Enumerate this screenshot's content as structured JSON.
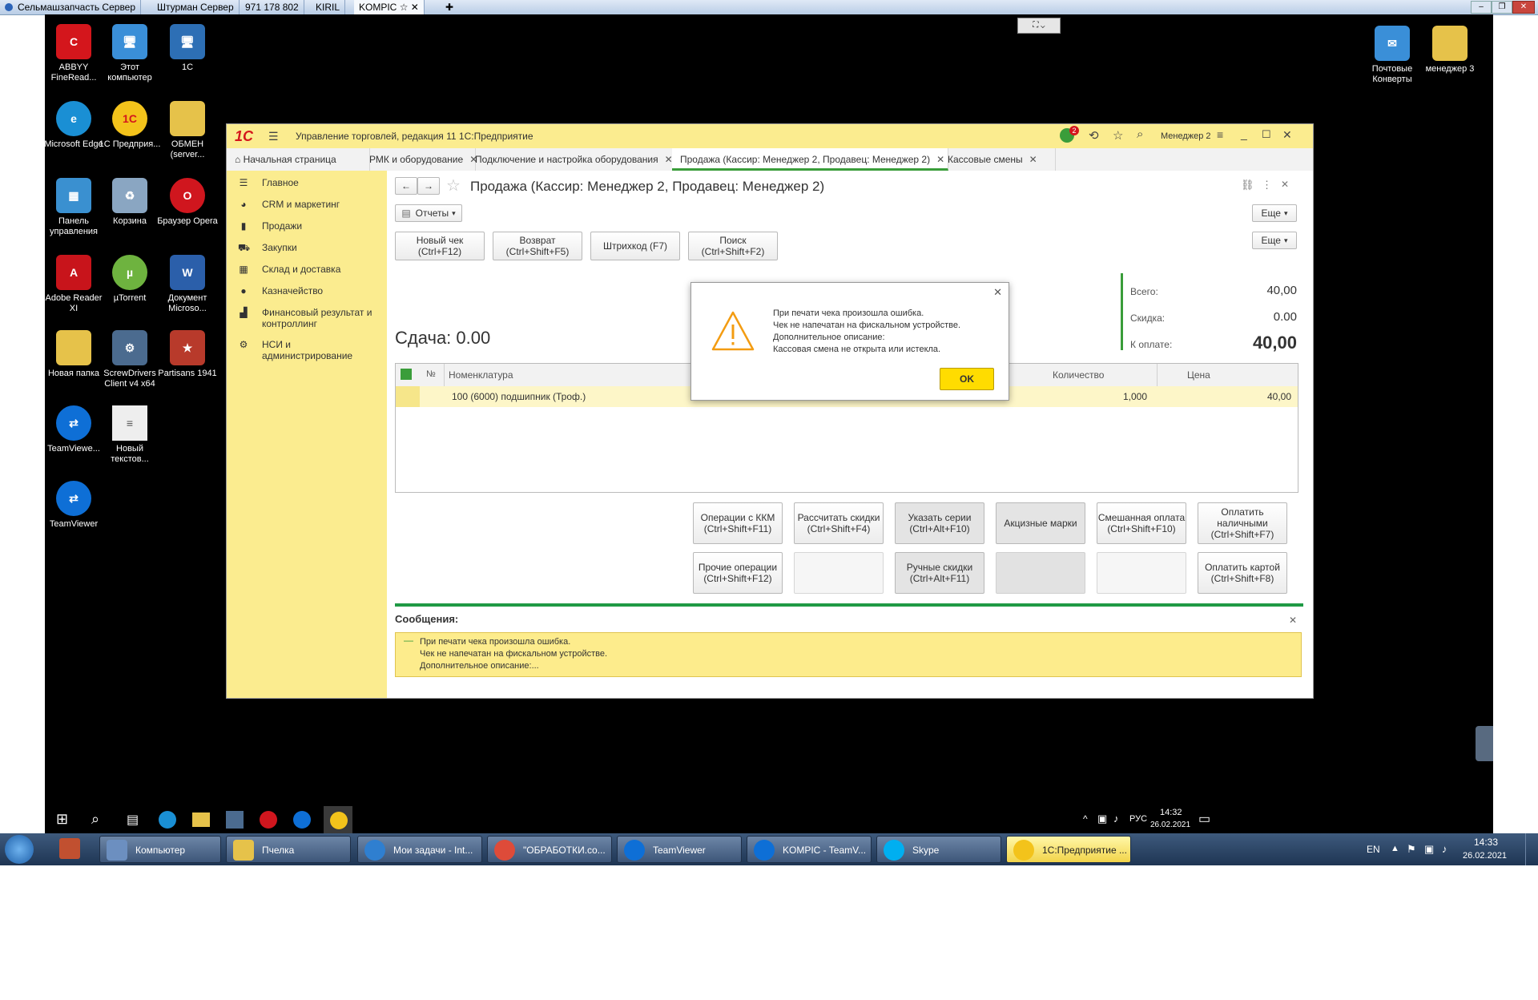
{
  "outer_tabs": [
    "Сельмашзапчасть Сервер",
    "Штурман Сервер",
    "971 178 802",
    "KIRIL",
    "KOMPIC"
  ],
  "desktop_icons": [
    {
      "label": "ABBYY FineRead...",
      "icon": "abbyy-icon",
      "color": "#d4161c"
    },
    {
      "label": "Этот компьютер",
      "icon": "computer-icon",
      "color": "#3a8fd8"
    },
    {
      "label": "1С",
      "icon": "1c-shortcut-icon",
      "color": "#2d6fb5"
    },
    {
      "label": "Microsoft Edge",
      "icon": "edge-icon",
      "color": "#1a8fd4"
    },
    {
      "label": "1С Предприя...",
      "icon": "1c-icon",
      "color": "#f3c31b"
    },
    {
      "label": "ОБМЕН (server...",
      "icon": "folder-icon",
      "color": "#e6c24a"
    },
    {
      "label": "Панель управления",
      "icon": "control-panel-icon",
      "color": "#3a90d0"
    },
    {
      "label": "Корзина",
      "icon": "recycle-bin-icon",
      "color": "#8aa6c2"
    },
    {
      "label": "Браузер Opera",
      "icon": "opera-icon",
      "color": "#d0161e"
    },
    {
      "label": "Adobe Reader XI",
      "icon": "adobe-icon",
      "color": "#c8141b"
    },
    {
      "label": "µTorrent",
      "icon": "utorrent-icon",
      "color": "#6eb33f"
    },
    {
      "label": "Документ Microso...",
      "icon": "word-icon",
      "color": "#2b5faa"
    },
    {
      "label": "Новая папка",
      "icon": "folder-icon",
      "color": "#e6c24a"
    },
    {
      "label": "ScrewDrivers Client v4 x64",
      "icon": "screwdrivers-icon",
      "color": "#4b6b8f"
    },
    {
      "label": "Partisans 1941",
      "icon": "partisans-icon",
      "color": "#b83a2b"
    },
    {
      "label": "TeamViewe...",
      "icon": "teamviewer-icon",
      "color": "#0e6fd6"
    },
    {
      "label": "Новый текстов...",
      "icon": "text-file-icon",
      "color": "#eeeeee"
    },
    {
      "label": "TeamViewer",
      "icon": "teamviewer-icon",
      "color": "#0e6fd6"
    },
    {
      "label": "Почтовые Конверты",
      "icon": "mail-icon",
      "color": "#3a8fd8"
    },
    {
      "label": "менеджер 3",
      "icon": "document-icon",
      "color": "#e6c24a"
    }
  ],
  "app": {
    "logo": "1С",
    "title": "Управление торговлей, редакция 11 1С:Предприятие",
    "user": "Менеджер 2",
    "notif_count": "2"
  },
  "tabs": [
    {
      "label": "Начальная страница"
    },
    {
      "label": "РМК и оборудование"
    },
    {
      "label": "Подключение и настройка оборудования"
    },
    {
      "label": "Продажа (Кассир: Менеджер 2, Продавец: Менеджер 2)"
    },
    {
      "label": "Кассовые смены"
    }
  ],
  "sidebar": [
    {
      "label": "Главное",
      "icon": "menu-lines-icon"
    },
    {
      "label": "CRM и маркетинг",
      "icon": "pie-icon"
    },
    {
      "label": "Продажи",
      "icon": "bag-icon"
    },
    {
      "label": "Закупки",
      "icon": "cart-icon"
    },
    {
      "label": "Склад и доставка",
      "icon": "grid-icon"
    },
    {
      "label": "Казначейство",
      "icon": "coin-icon"
    },
    {
      "label": "Финансовый результат и контроллинг",
      "icon": "bar-chart-icon"
    },
    {
      "label": "НСИ и администрирование",
      "icon": "gear-icon"
    }
  ],
  "doc": {
    "title": "Продажа (Кассир: Менеджер 2, Продавец: Менеджер 2)",
    "reports_label": "Отчеты",
    "more_label": "Еще",
    "top_buttons": [
      {
        "label": "Новый чек (Ctrl+F12)"
      },
      {
        "label": "Возврат (Ctrl+Shift+F5)"
      },
      {
        "label": "Штрихкод (F7)"
      },
      {
        "label": "Поиск (Ctrl+Shift+F2)"
      }
    ],
    "change": "Сдача: 0.00",
    "totals": [
      {
        "label": "Всего:",
        "value": "40,00"
      },
      {
        "label": "Скидка:",
        "value": "0.00"
      },
      {
        "label": "К оплате:",
        "value": "40,00"
      }
    ],
    "table_headers": {
      "num": "№",
      "name": "Номенклатура",
      "qty": "Количество",
      "price": "Цена"
    },
    "rows": [
      {
        "name": "100 (6000) подшипник (Троф.)",
        "qty": "1,000",
        "price": "40,00"
      }
    ],
    "action_buttons": [
      {
        "label": "Операции с ККМ (Ctrl+Shift+F11)"
      },
      {
        "label": "Рассчитать скидки (Ctrl+Shift+F4)"
      },
      {
        "label": "Указать серии (Ctrl+Alt+F10)"
      },
      {
        "label": "Акцизные марки"
      },
      {
        "label": "Смешанная оплата (Ctrl+Shift+F10)"
      },
      {
        "label": "Оплатить наличными (Ctrl+Shift+F7)"
      },
      {
        "label": "Прочие операции (Ctrl+Shift+F12)"
      },
      {
        "label": ""
      },
      {
        "label": "Ручные скидки (Ctrl+Alt+F11)"
      },
      {
        "label": ""
      },
      {
        "label": ""
      },
      {
        "label": "Оплатить картой (Ctrl+Shift+F8)"
      }
    ],
    "messages_title": "Сообщения:",
    "messages": [
      "При печати чека произошла ошибка.",
      "Чек не напечатан на фискальном устройстве.",
      "Дополнительное описание:..."
    ]
  },
  "dialog": {
    "lines": [
      "При печати чека произошла ошибка.",
      "Чек не напечатан на фискальном устройстве.",
      "Дополнительное описание:",
      "Кассовая смена не открыта или истекла."
    ],
    "ok_label": "OK"
  },
  "remote_tray": {
    "lang": "РУС",
    "time": "14:32",
    "date": "26.02.2021"
  },
  "win7_taskbar": [
    {
      "label": "Компьютер",
      "icon": "computer-icon",
      "color": "#6c8fc0"
    },
    {
      "label": "Пчелка",
      "icon": "folder-icon",
      "color": "#e6c24a"
    },
    {
      "label": "Мои задачи - Int...",
      "icon": "ie-icon",
      "color": "#2f7fd0"
    },
    {
      "label": "\"ОБРАБОТКИ.co...",
      "icon": "chrome-icon",
      "color": "#de4b39"
    },
    {
      "label": "TeamViewer",
      "icon": "teamviewer-icon",
      "color": "#0e6fd6"
    },
    {
      "label": "KOMPIC - TeamV...",
      "icon": "teamviewer-icon",
      "color": "#0e6fd6"
    },
    {
      "label": "Skype",
      "icon": "skype-icon",
      "color": "#00aff0"
    },
    {
      "label": "1С:Предприятие ...",
      "icon": "1c-icon",
      "color": "#f3c31b"
    }
  ],
  "win7_tray": {
    "lang": "EN",
    "time": "14:33",
    "date": "26.02.2021"
  },
  "colors": {
    "accent_yellow": "#fbec8f",
    "green": "#3a9d3a",
    "ok_yellow": "#ffdc00"
  }
}
